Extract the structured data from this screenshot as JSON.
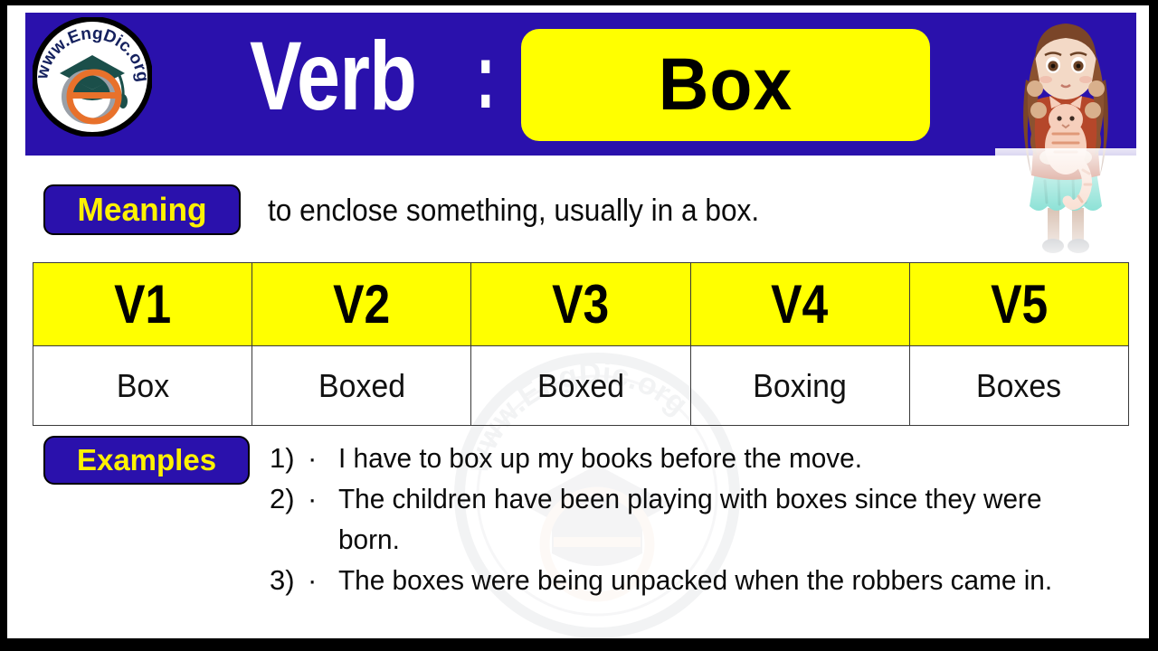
{
  "colors": {
    "purple": "#2A11AC",
    "yellow": "#FFFF00",
    "badge_text_yellow": "#FFF200",
    "black": "#000000",
    "white": "#FFFFFF",
    "logo_cap_teal": "#1B4F4A",
    "logo_e_orange": "#E8712B",
    "girl_shirt": "#B5472A",
    "girl_skirt": "#4FD2C0",
    "girl_hair": "#7A4528"
  },
  "header": {
    "label": "Verb",
    "separator": ":",
    "word": "Box",
    "logo": {
      "site_text": "www.EngDic.org",
      "letter": "e",
      "icon_name": "engdic-logo"
    },
    "illustration_name": "girl-holding-cat-illustration"
  },
  "meaning": {
    "badge_label": "Meaning",
    "text": "to enclose something, usually in a box."
  },
  "forms_table": {
    "headers": [
      "V1",
      "V2",
      "V3",
      "V4",
      "V5"
    ],
    "values": [
      "Box",
      "Boxed",
      "Boxed",
      "Boxing",
      "Boxes"
    ]
  },
  "examples": {
    "badge_label": "Examples",
    "items": [
      {
        "number": "1)",
        "bullet": "·",
        "text": "I have to box up my books before the move."
      },
      {
        "number": "2)",
        "bullet": "·",
        "text": "The children have been playing with boxes since they were born."
      },
      {
        "number": "3)",
        "bullet": "·",
        "text": "The boxes were being unpacked when the robbers came in."
      }
    ]
  },
  "watermark": {
    "text": "www.EngDic.org",
    "letter": "e"
  }
}
